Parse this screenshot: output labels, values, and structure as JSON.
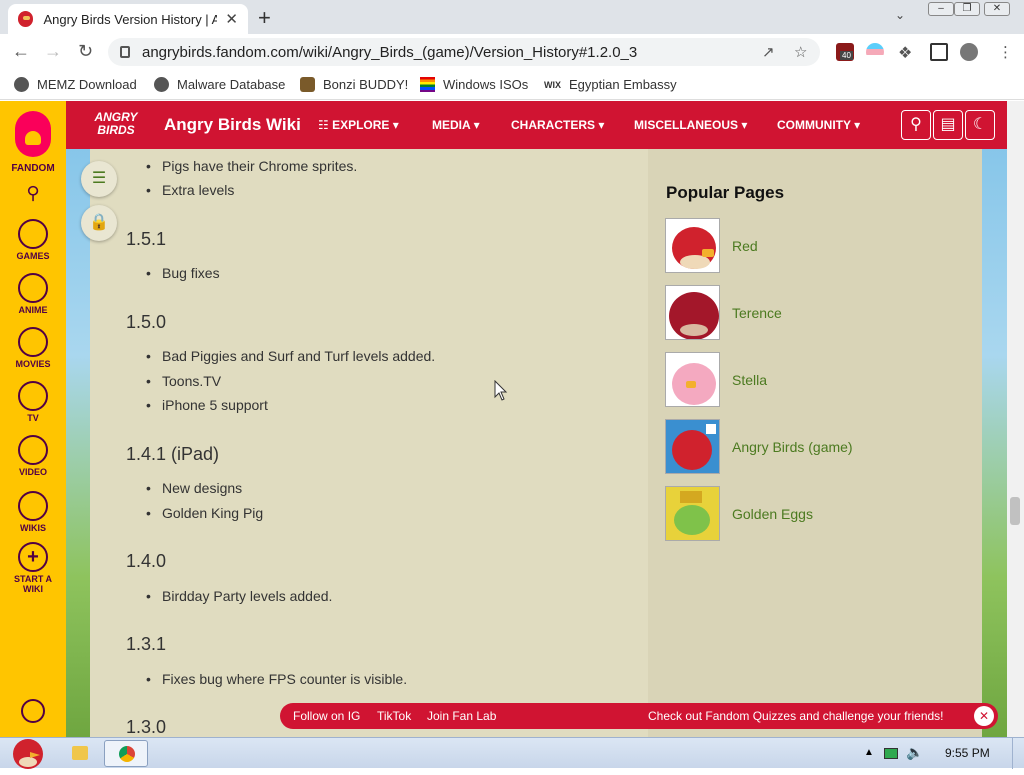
{
  "browser": {
    "tab_title": "Angry Birds Version History | A",
    "tab_close": "✕",
    "new_tab": "+",
    "url": "angrybirds.fandom.com/wiki/Angry_Birds_(game)/Version_History#1.2.0_3",
    "extension_badge": "40",
    "bookmarks": [
      "MEMZ Download",
      "Malware Database",
      "Bonzi BUDDY!",
      "Windows ISOs",
      "Egyptian Embassy"
    ]
  },
  "rail": {
    "logo_label": "FANDOM",
    "items": [
      "GAMES",
      "ANIME",
      "MOVIES",
      "TV",
      "VIDEO",
      "WIKIS",
      "START A WIKI"
    ]
  },
  "header": {
    "logo_text": "ANGRY BIRDS",
    "wiki_name": "Angry Birds Wiki",
    "nav": [
      "EXPLORE",
      "MEDIA",
      "CHARACTERS",
      "MISCELLANEOUS",
      "COMMUNITY"
    ]
  },
  "content": {
    "top_bullets": [
      "Pigs have their Chrome sprites.",
      "Extra levels"
    ],
    "sections": [
      {
        "heading": "1.5.1",
        "bullets": [
          "Bug fixes"
        ]
      },
      {
        "heading": "1.5.0",
        "bullets": [
          "Bad Piggies and Surf and Turf levels added.",
          "Toons.TV",
          "iPhone 5 support"
        ]
      },
      {
        "heading": "1.4.1 (iPad)",
        "bullets": [
          "New designs",
          "Golden King Pig"
        ]
      },
      {
        "heading": "1.4.0",
        "bullets": [
          "Birdday Party levels added."
        ]
      },
      {
        "heading": "1.3.1",
        "bullets": [
          "Fixes bug where FPS counter is visible."
        ]
      },
      {
        "heading": "1.3.0",
        "bullets": []
      }
    ]
  },
  "sidebar": {
    "title": "Popular Pages",
    "items": [
      "Red",
      "Terence",
      "Stella",
      "Angry Birds (game)",
      "Golden Eggs"
    ]
  },
  "promo": {
    "follow_ig": "Follow on IG",
    "tiktok": "TikTok",
    "fan_lab": "Join Fan Lab",
    "quizzes": "Check out Fandom Quizzes and challenge your friends!"
  },
  "taskbar": {
    "time": "9:55 PM"
  },
  "colors": {
    "fandom_yellow": "#ffc500",
    "wiki_red": "#d01432",
    "link_green": "#4c7a20",
    "content_bg": "#e0dcc0"
  }
}
